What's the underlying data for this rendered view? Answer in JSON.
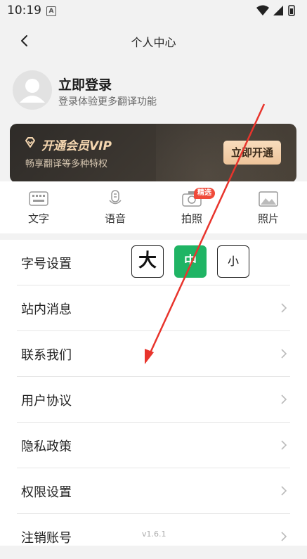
{
  "status_bar": {
    "time": "10:19",
    "notification_glyph": "A"
  },
  "header": {
    "title": "个人中心",
    "back_icon": "chevron-left-icon"
  },
  "profile": {
    "title": "立即登录",
    "subtitle": "登录体验更多翻译功能"
  },
  "vip": {
    "title": "开通会员VIP",
    "subtitle": "畅享翻译等多种特权",
    "button": "立即开通",
    "accent": "#f5d7b0"
  },
  "tools": [
    {
      "label": "文字",
      "icon": "keyboard-icon"
    },
    {
      "label": "语音",
      "icon": "microphone-icon"
    },
    {
      "label": "拍照",
      "icon": "camera-icon",
      "badge": "精选"
    },
    {
      "label": "照片",
      "icon": "image-icon"
    }
  ],
  "settings": {
    "font_size": {
      "label": "字号设置",
      "options": [
        "大",
        "中",
        "小"
      ],
      "selected": "中",
      "selected_color": "#1fb464"
    },
    "items": [
      "站内消息",
      "联系我们",
      "用户协议",
      "隐私政策",
      "权限设置",
      "注销账号"
    ]
  },
  "version": "v1.6.1",
  "annotation": {
    "color": "#e8342c"
  }
}
